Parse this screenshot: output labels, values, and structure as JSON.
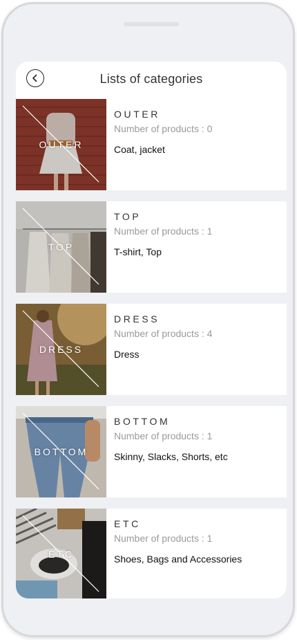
{
  "header": {
    "title": "Lists of categories",
    "back_icon": "chevron-left-icon"
  },
  "categories": [
    {
      "thumb_label": "OUTER",
      "name": "OUTER",
      "count_text": "Number of products : 0",
      "desc": "Coat, jacket"
    },
    {
      "thumb_label": "TOP",
      "name": "TOP",
      "count_text": "Number of products : 1",
      "desc": "T-shirt, Top"
    },
    {
      "thumb_label": "DRESS",
      "name": "DRESS",
      "count_text": "Number of products : 4",
      "desc": "Dress"
    },
    {
      "thumb_label": "BOTTOM",
      "name": "BOTTOM",
      "count_text": "Number of products : 1",
      "desc": "Skinny, Slacks, Shorts, etc"
    },
    {
      "thumb_label": "ETC",
      "name": "ETC",
      "count_text": "Number of products : 1",
      "desc": "Shoes, Bags and Accessories"
    }
  ],
  "colors": {
    "background": "#eef0f3",
    "card": "#ffffff",
    "muted_text": "#9a9a9a"
  }
}
